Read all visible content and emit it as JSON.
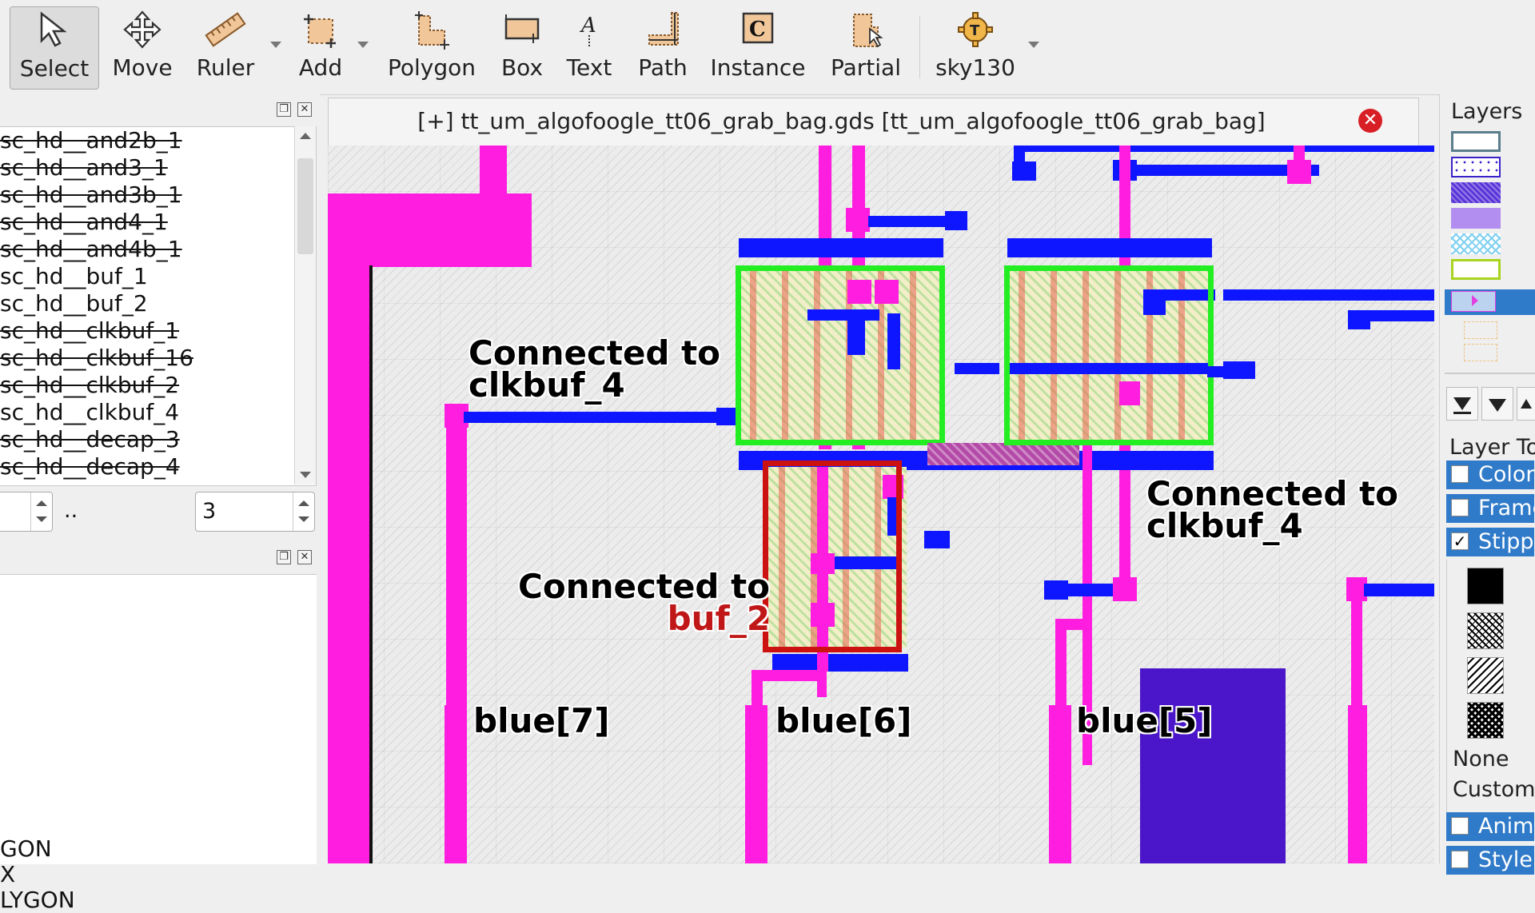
{
  "toolbar": {
    "tools": [
      {
        "id": "select",
        "label": "Select",
        "icon": "select-arrow-icon",
        "active": true
      },
      {
        "id": "move",
        "label": "Move",
        "icon": "move-arrows-icon"
      },
      {
        "id": "ruler",
        "label": "Ruler",
        "icon": "ruler-icon"
      },
      {
        "id": "add",
        "label": "Add",
        "icon": "add-shape-icon"
      },
      {
        "id": "polygon",
        "label": "Polygon",
        "icon": "polygon-icon"
      },
      {
        "id": "box",
        "label": "Box",
        "icon": "box-icon"
      },
      {
        "id": "text",
        "label": "Text",
        "icon": "text-a-icon"
      },
      {
        "id": "path",
        "label": "Path",
        "icon": "path-icon"
      },
      {
        "id": "instance",
        "label": "Instance",
        "icon": "instance-c-icon"
      },
      {
        "id": "partial",
        "label": "Partial",
        "icon": "partial-icon"
      },
      {
        "id": "sky130",
        "label": "sky130",
        "icon": "sky130-gear-icon"
      }
    ]
  },
  "cells_panel": {
    "items": [
      {
        "name": "sc_hd__and2b_1",
        "hidden": true
      },
      {
        "name": "sc_hd__and3_1",
        "hidden": true
      },
      {
        "name": "sc_hd__and3b_1",
        "hidden": true
      },
      {
        "name": "sc_hd__and4_1",
        "hidden": true
      },
      {
        "name": "sc_hd__and4b_1",
        "hidden": true
      },
      {
        "name": "sc_hd__buf_1",
        "hidden": false
      },
      {
        "name": "sc_hd__buf_2",
        "hidden": false
      },
      {
        "name": "sc_hd__clkbuf_1",
        "hidden": true
      },
      {
        "name": "sc_hd__clkbuf_16",
        "hidden": true
      },
      {
        "name": "sc_hd__clkbuf_2",
        "hidden": true
      },
      {
        "name": "sc_hd__clkbuf_4",
        "hidden": false
      },
      {
        "name": "sc_hd__decap_3",
        "hidden": true
      },
      {
        "name": "sc_hd__decap_4",
        "hidden": true
      }
    ],
    "hier_from": "",
    "hier_sep": "..",
    "hier_to": "3"
  },
  "properties_panel": {
    "items": [
      "GON",
      "X",
      "LYGON"
    ]
  },
  "document": {
    "tab_title": "[+] tt_um_algofoogle_tt06_grab_bag.gds [tt_um_algofoogle_tt06_grab_bag]",
    "close_symbol": "✕"
  },
  "annotations": {
    "conn1_line1": "Connected to",
    "conn1_line2": "clkbuf_4",
    "conn2_line1": "Connected to",
    "conn2_line2": "clkbuf_4",
    "conn3_line1": "Connected to",
    "conn3_line2": "buf_2",
    "blue7": "blue[7]",
    "blue6": "blue[6]",
    "blue5": "blue[5]"
  },
  "layers_panel": {
    "title": "Layers",
    "layer_toolbox_title": "Layer Toolbox",
    "options": [
      {
        "label": "Color",
        "checked": false
      },
      {
        "label": "Frame",
        "checked": false
      },
      {
        "label": "Stipple",
        "checked": true
      }
    ],
    "stipple_none": "None",
    "stipple_custom": "Custom",
    "extra_options": [
      {
        "label": "Animation",
        "checked": false
      },
      {
        "label": "Style",
        "checked": false
      }
    ],
    "colors": {
      "metal_pink": "#ff1ee0",
      "metal_blue": "#0e16ff",
      "highlight_green": "#22ee22",
      "highlight_red": "#cc1111",
      "selection": "#2f7ac9"
    }
  }
}
